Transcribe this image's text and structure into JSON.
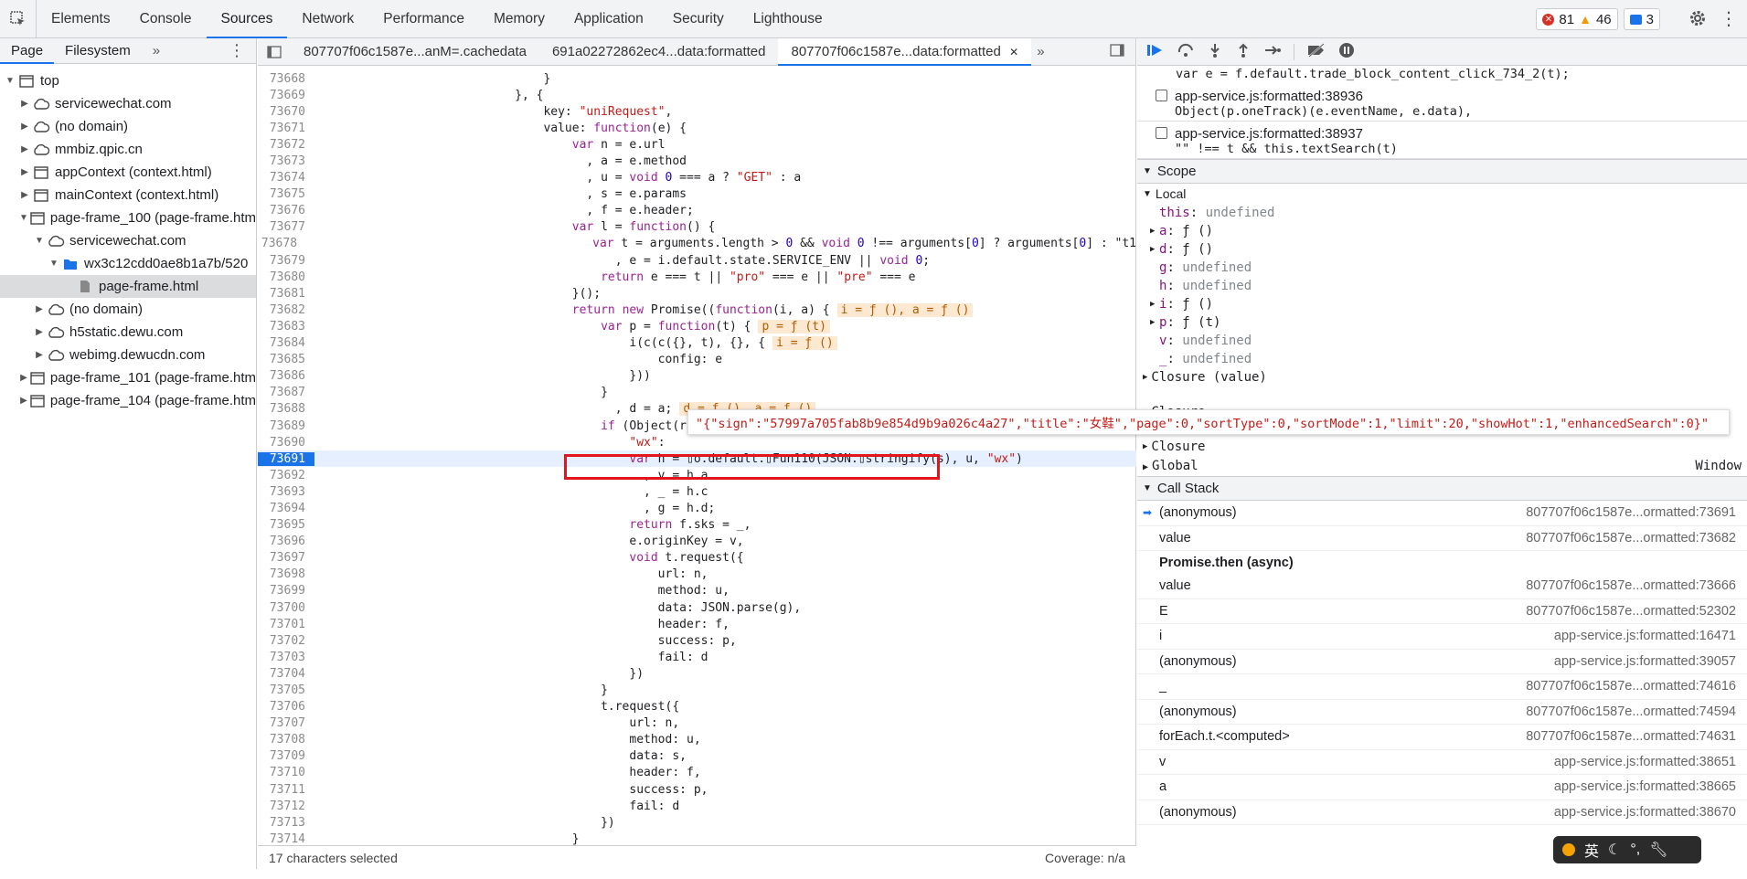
{
  "topbar": {
    "tabs": [
      "Elements",
      "Console",
      "Sources",
      "Network",
      "Performance",
      "Memory",
      "Application",
      "Security",
      "Lighthouse"
    ],
    "active_tab": "Sources",
    "errors": "81",
    "warnings": "46",
    "messages": "3"
  },
  "leftnav": {
    "tabs": [
      "Page",
      "Filesystem"
    ],
    "tree": [
      {
        "label": "top",
        "depth": 0,
        "arrow": "▼",
        "icon": "frame"
      },
      {
        "label": "servicewechat.com",
        "depth": 1,
        "arrow": "▶",
        "icon": "cloud"
      },
      {
        "label": "(no domain)",
        "depth": 1,
        "arrow": "▶",
        "icon": "cloud"
      },
      {
        "label": "mmbiz.qpic.cn",
        "depth": 1,
        "arrow": "▶",
        "icon": "cloud"
      },
      {
        "label": "appContext (context.html)",
        "depth": 1,
        "arrow": "▶",
        "icon": "frame"
      },
      {
        "label": "mainContext (context.html)",
        "depth": 1,
        "arrow": "▶",
        "icon": "frame"
      },
      {
        "label": "page-frame_100 (page-frame.htm",
        "depth": 1,
        "arrow": "▼",
        "icon": "frame"
      },
      {
        "label": "servicewechat.com",
        "depth": 2,
        "arrow": "▼",
        "icon": "cloud"
      },
      {
        "label": "wx3c12cdd0ae8b1a7b/520",
        "depth": 3,
        "arrow": "▼",
        "icon": "folder"
      },
      {
        "label": "page-frame.html",
        "depth": 4,
        "arrow": "",
        "icon": "file"
      },
      {
        "label": "(no domain)",
        "depth": 2,
        "arrow": "▶",
        "icon": "cloud"
      },
      {
        "label": "h5static.dewu.com",
        "depth": 2,
        "arrow": "▶",
        "icon": "cloud"
      },
      {
        "label": "webimg.dewucdn.com",
        "depth": 2,
        "arrow": "▶",
        "icon": "cloud"
      },
      {
        "label": "page-frame_101 (page-frame.htm",
        "depth": 1,
        "arrow": "▶",
        "icon": "frame"
      },
      {
        "label": "page-frame_104 (page-frame.htm",
        "depth": 1,
        "arrow": "▶",
        "icon": "frame"
      }
    ]
  },
  "editor": {
    "tabs": [
      "807707f06c1587e...anM=.cachedata",
      "691a02272862ec4...data:formatted",
      "807707f06c1587e...data:formatted"
    ],
    "active_tab": 2,
    "lines": [
      {
        "n": "73668",
        "t": "                                }"
      },
      {
        "n": "73669",
        "t": "                            }, {"
      },
      {
        "n": "73670",
        "t": "                                key: \"uniRequest\","
      },
      {
        "n": "73671",
        "t": "                                value: function(e) {"
      },
      {
        "n": "73672",
        "t": "                                    var n = e.url"
      },
      {
        "n": "73673",
        "t": "                                      , a = e.method"
      },
      {
        "n": "73674",
        "t": "                                      , u = void 0 === a ? \"GET\" : a"
      },
      {
        "n": "73675",
        "t": "                                      , s = e.params"
      },
      {
        "n": "73676",
        "t": "                                      , f = e.header;"
      },
      {
        "n": "73677",
        "t": "                                    var l = function() {"
      },
      {
        "n": "73678",
        "t": "                                        var t = arguments.length > 0 && void 0 !== arguments[0] ? arguments[0] : \"t1"
      },
      {
        "n": "73679",
        "t": "                                          , e = i.default.state.SERVICE_ENV || void 0;"
      },
      {
        "n": "73680",
        "t": "                                        return e === t || \"pro\" === e || \"pre\" === e"
      },
      {
        "n": "73681",
        "t": "                                    }();"
      },
      {
        "n": "73682",
        "t": "                                    return new Promise((function(i, a) {",
        "h": "i = ƒ (), a = ƒ ()"
      },
      {
        "n": "73683",
        "t": "                                        var p = function(t) {",
        "h": "p = ƒ (t)"
      },
      {
        "n": "73684",
        "t": "                                            i(c(c({}, t), {}, {",
        "h": "i = ƒ ()"
      },
      {
        "n": "73685",
        "t": "                                                config: e"
      },
      {
        "n": "73686",
        "t": "                                            }))"
      },
      {
        "n": "73687",
        "t": "                                        }"
      },
      {
        "n": "73688",
        "t": "                                          , d = a;",
        "h": "d = ƒ (), a = ƒ ()"
      },
      {
        "n": "73689",
        "t": "                                        if (Object(r.chec"
      },
      {
        "n": "73690",
        "t": "                                            \"wx\":"
      },
      {
        "n": "73691",
        "t": "                                            var h = ▯o.default.▯Fun110(JSON.▯stringify(s), u, \"wx\")",
        "cur": true
      },
      {
        "n": "73692",
        "t": "                                              , v = h.a"
      },
      {
        "n": "73693",
        "t": "                                              , _ = h.c"
      },
      {
        "n": "73694",
        "t": "                                              , g = h.d;"
      },
      {
        "n": "73695",
        "t": "                                            return f.sks = _,"
      },
      {
        "n": "73696",
        "t": "                                            e.originKey = v,"
      },
      {
        "n": "73697",
        "t": "                                            void t.request({"
      },
      {
        "n": "73698",
        "t": "                                                url: n,"
      },
      {
        "n": "73699",
        "t": "                                                method: u,"
      },
      {
        "n": "73700",
        "t": "                                                data: JSON.parse(g),"
      },
      {
        "n": "73701",
        "t": "                                                header: f,"
      },
      {
        "n": "73702",
        "t": "                                                success: p,"
      },
      {
        "n": "73703",
        "t": "                                                fail: d"
      },
      {
        "n": "73704",
        "t": "                                            })"
      },
      {
        "n": "73705",
        "t": "                                        }"
      },
      {
        "n": "73706",
        "t": "                                        t.request({"
      },
      {
        "n": "73707",
        "t": "                                            url: n,"
      },
      {
        "n": "73708",
        "t": "                                            method: u,"
      },
      {
        "n": "73709",
        "t": "                                            data: s,"
      },
      {
        "n": "73710",
        "t": "                                            header: f,"
      },
      {
        "n": "73711",
        "t": "                                            success: p,"
      },
      {
        "n": "73712",
        "t": "                                            fail: d"
      },
      {
        "n": "73713",
        "t": "                                        })"
      },
      {
        "n": "73714",
        "t": "                                    }"
      }
    ],
    "tooltip": "\"{\"sign\":\"57997a705fab8b9e854d9b9a026c4a27\",\"title\":\"女鞋\",\"page\":0,\"sortType\":0,\"sortMode\":1,\"limit\":20,\"showHot\":1,\"enhancedSearch\":0}\"",
    "status_left": "17 characters selected",
    "status_right": "Coverage: n/a"
  },
  "right": {
    "top_line": "var e = f.default.trade_block_content_click_734_2(t);",
    "breakpoints": [
      {
        "file": "app-service.js:formatted:38936",
        "code": "Object(p.oneTrack)(e.eventName, e.data),"
      },
      {
        "file": "app-service.js:formatted:38937",
        "code": "\"\" !== t && this.textSearch(t)"
      }
    ],
    "scope_title": "Scope",
    "local_title": "Local",
    "scope_vars": [
      {
        "arrow": "",
        "name": "this",
        "val": "undefined"
      },
      {
        "arrow": "▶",
        "name": "a",
        "val": "ƒ ()"
      },
      {
        "arrow": "▶",
        "name": "d",
        "val": "ƒ ()"
      },
      {
        "arrow": "",
        "name": "g",
        "val": "undefined"
      },
      {
        "arrow": "",
        "name": "h",
        "val": "undefined"
      },
      {
        "arrow": "▶",
        "name": "i",
        "val": "ƒ ()"
      },
      {
        "arrow": "▶",
        "name": "p",
        "val": "ƒ (t)"
      },
      {
        "arrow": "",
        "name": "v",
        "val": "undefined"
      },
      {
        "arrow": "",
        "name": "_",
        "val": "undefined"
      }
    ],
    "closures": [
      "Closure (value)",
      "Closure",
      "Closure (55)",
      "Closure"
    ],
    "global_label": "Global",
    "global_val": "Window",
    "callstack_title": "Call Stack",
    "callstack": [
      {
        "fn": "(anonymous)",
        "loc": "807707f06c1587e...ormatted:73691",
        "cur": true
      },
      {
        "fn": "value",
        "loc": "807707f06c1587e...ormatted:73682"
      },
      {
        "sep": "Promise.then (async)"
      },
      {
        "fn": "value",
        "loc": "807707f06c1587e...ormatted:73666"
      },
      {
        "fn": "E",
        "loc": "807707f06c1587e...ormatted:52302"
      },
      {
        "fn": "i",
        "loc": "app-service.js:formatted:16471"
      },
      {
        "fn": "(anonymous)",
        "loc": "app-service.js:formatted:39057"
      },
      {
        "fn": "_",
        "loc": "807707f06c1587e...ormatted:74616"
      },
      {
        "fn": "(anonymous)",
        "loc": "807707f06c1587e...ormatted:74594"
      },
      {
        "fn": "forEach.t.<computed>",
        "loc": "807707f06c1587e...ormatted:74631"
      },
      {
        "fn": "v",
        "loc": "app-service.js:formatted:38651"
      },
      {
        "fn": "a",
        "loc": "app-service.js:formatted:38665"
      },
      {
        "fn": "(anonymous)",
        "loc": "app-service.js:formatted:38670"
      }
    ]
  },
  "ime": {
    "label": "英"
  }
}
